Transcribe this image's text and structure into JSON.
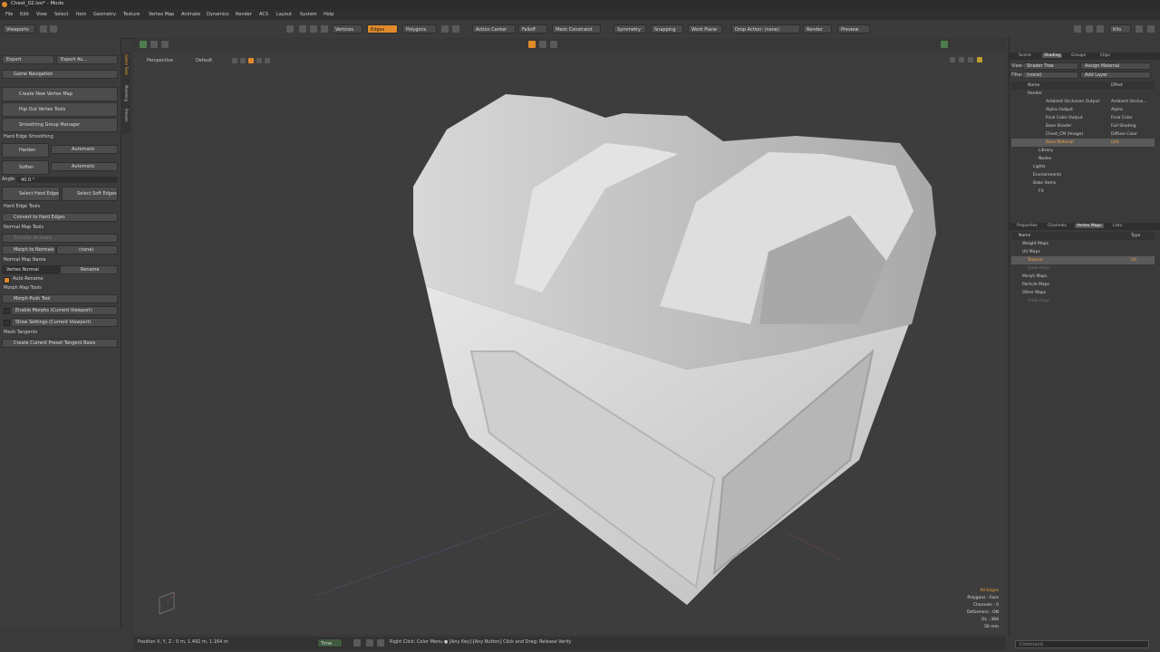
{
  "window": {
    "title": "Chest_02.lxo* - Modo"
  },
  "menu": [
    "File",
    "Edit",
    "View",
    "Select",
    "Item",
    "Geometry",
    "Texture",
    "Vertex Map",
    "Animate",
    "Dynamics",
    "Render",
    "ACS",
    "Layout",
    "System",
    "Help"
  ],
  "toolbar": {
    "viewports": "Viewports",
    "vertices": "Vertices",
    "edges": "Edges",
    "polygons": "Polygons",
    "action_center": "Action Center",
    "falloff": "Falloff",
    "mesh_constraint": "Mesh Constraint",
    "symmetry": "Symmetry",
    "snapping": "Snapping",
    "work_plane": "Work Plane",
    "drop_action": "Drop Action: (none)",
    "render": "Render",
    "preview": "Preview",
    "kits": "Kits"
  },
  "left": {
    "export": "Export",
    "export_as": "Export As...",
    "game_navigation": "Game Navigation",
    "create_vertex_map": "Create New Vertex Map",
    "pop_out": "Pop Out Vertex Tools",
    "smoothing": "Smoothing Group Manager",
    "hard_edge_smoothing": "Hard Edge Smoothing",
    "harden": "Harden",
    "harden_mode": "Automatic",
    "soften": "Soften",
    "soften_mode": "Automatic",
    "angle_label": "Angle",
    "angle_value": "40.0 °",
    "select_hard": "Select Hard Edges",
    "select_soft": "Select Soft Edges",
    "hard_edge_tools": "Hard Edge Tools",
    "convert": "Convert to Hard Edges",
    "normal_map_tools": "Normal Map Tools",
    "transfer_normals": "Transfer Normals",
    "morph_to_normals": "Morph to Normals",
    "morph_value": "(none)",
    "normal_map_name": "Normal Map Name",
    "vertex_normal": "Vertex Normal",
    "rename": "Rename",
    "auto_rename": "Auto Rename",
    "morph_map_tools": "Morph Map Tools",
    "morph_push": "Morph Push Tool",
    "enable_morphs": "Enable Morphs (Current Viewport)",
    "show_settings": "Show Settings (Current Viewport)",
    "mesh_tangents": "Mesh Tangents",
    "create_tangent": "Create Current Preset Tangent Basis",
    "side_tabs": [
      "Game Tools",
      "Modeling",
      "Presets"
    ]
  },
  "viewport": {
    "view_name": "Perspective",
    "shading": "Default",
    "info": [
      "All Edges",
      "Polygons : Face",
      "Channels : 0",
      "Deformers : ON",
      "GL : 384",
      "50 mm"
    ]
  },
  "status": {
    "position": "Position X, Y, Z :  0 m, 1.492 m, 1.164 m",
    "time": "Time",
    "hint": "Right Click: Color Menu ● [Any Key]-[Any Button] Click and Drag: Release Verify"
  },
  "right": {
    "top_tabs": [
      "Scene",
      "Shading",
      "Groups",
      "Clips"
    ],
    "top_selected": "Shading",
    "view_label": "View",
    "view_value": "Shader Tree",
    "assign": "Assign Material",
    "filter_label": "Filter",
    "filter_value": "(none)",
    "add_layer": "Add Layer",
    "col_name": "Name",
    "col_effect": "Effect",
    "shader_rows": [
      {
        "name": "Render",
        "effect": ""
      },
      {
        "name": "Ambient Occlusion Output",
        "effect": "Ambient Occlus..."
      },
      {
        "name": "Alpha Output",
        "effect": "Alpha"
      },
      {
        "name": "Final Color Output",
        "effect": "Final Color"
      },
      {
        "name": "Base Shader",
        "effect": "Full Shading"
      },
      {
        "name": "Chest_CM (Image)",
        "effect": "Diffuse Color"
      },
      {
        "name": "Base Material",
        "effect": "(all)"
      },
      {
        "name": "Library",
        "effect": ""
      },
      {
        "name": "Nodes",
        "effect": ""
      },
      {
        "name": "Lights",
        "effect": ""
      },
      {
        "name": "Environments",
        "effect": ""
      },
      {
        "name": "Bake Items",
        "effect": ""
      },
      {
        "name": "FX",
        "effect": ""
      }
    ],
    "bottom_tabs": [
      "Properties",
      "Channels",
      "Vertex Maps",
      "Lists"
    ],
    "bottom_selected": "Vertex Maps",
    "vm_col_name": "Name",
    "vm_col_type": "Type",
    "vmap_rows": [
      {
        "name": "Weight Maps",
        "type": ""
      },
      {
        "name": "UV Maps",
        "type": ""
      },
      {
        "name": "Texture",
        "type": "UV"
      },
      {
        "name": "(new map)",
        "type": ""
      },
      {
        "name": "Morph Maps",
        "type": ""
      },
      {
        "name": "Particle Maps",
        "type": ""
      },
      {
        "name": "Other Maps",
        "type": ""
      },
      {
        "name": "(new map)",
        "type": ""
      }
    ],
    "command_placeholder": "Command"
  }
}
